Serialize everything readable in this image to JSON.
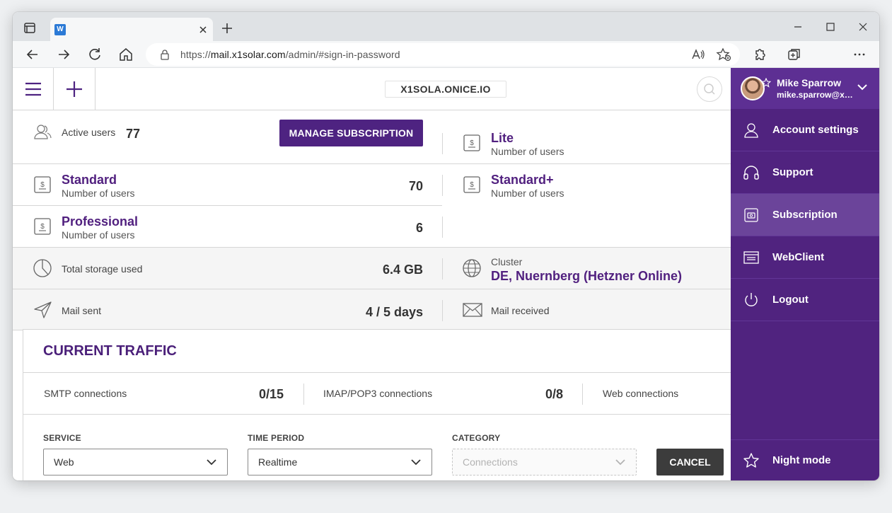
{
  "browser": {
    "tab_favicon": "W",
    "url_prefix": "https://",
    "url_host": "mail.x1solar.com",
    "url_path": "/admin/#sign-in-password"
  },
  "header": {
    "domain": "X1SOLA.ONICE.IO"
  },
  "overview": {
    "active_users_label": "Active users",
    "active_users_value": "77",
    "manage_button": "MANAGE SUBSCRIPTION",
    "lite_title": "Lite",
    "lite_sub": "Number of users",
    "standard_title": "Standard",
    "standard_sub": "Number of users",
    "standard_value": "70",
    "standard_plus_title": "Standard+",
    "standard_plus_sub": "Number of users",
    "professional_title": "Professional",
    "professional_sub": "Number of users",
    "professional_value": "6",
    "storage_label": "Total storage used",
    "storage_value": "6.4 GB",
    "cluster_label": "Cluster",
    "cluster_value": "DE, Nuernberg (Hetzner Online)",
    "mail_sent_label": "Mail sent",
    "mail_sent_value": "4 / 5 days",
    "mail_received_label": "Mail received"
  },
  "traffic": {
    "title": "CURRENT TRAFFIC",
    "smtp_label": "SMTP connections",
    "smtp_value": "0/15",
    "imap_label": "IMAP/POP3 connections",
    "imap_value": "0/8",
    "web_label": "Web connections",
    "service_label": "SERVICE",
    "service_value": "Web",
    "period_label": "TIME PERIOD",
    "period_value": "Realtime",
    "category_label": "CATEGORY",
    "category_placeholder": "Connections",
    "cancel_button": "CANCEL"
  },
  "side_menu": {
    "user_name": "Mike Sparrow",
    "user_email": "mike.sparrow@x…",
    "items": [
      {
        "label": "Account settings",
        "icon": "user-icon"
      },
      {
        "label": "Support",
        "icon": "headset-icon"
      },
      {
        "label": "Subscription",
        "icon": "subscription-icon",
        "active": true
      },
      {
        "label": "WebClient",
        "icon": "webclient-icon"
      },
      {
        "label": "Logout",
        "icon": "power-icon"
      }
    ],
    "night_mode": "Night mode"
  },
  "colors": {
    "brand_purple": "#50237f",
    "button_purple": "#4e2381",
    "title_purple": "#51207f",
    "cancel_dark": "#3c3c3c"
  }
}
